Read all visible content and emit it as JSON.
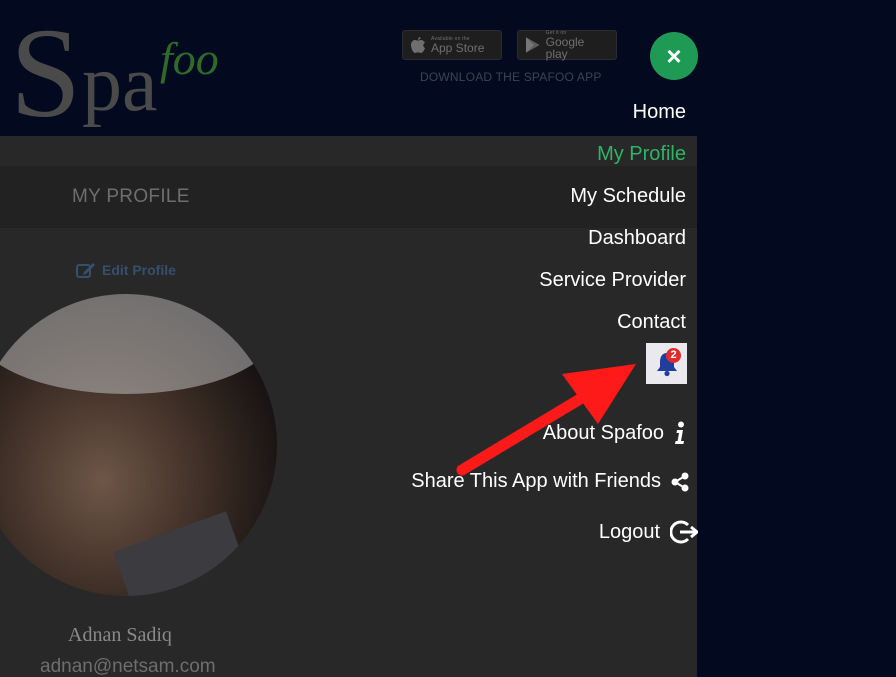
{
  "app": {
    "logo_text": "Spafoo"
  },
  "header": {
    "app_store": {
      "small": "Available on the",
      "big": "App Store"
    },
    "google_play": {
      "small": "Get it on",
      "big": "Google play"
    },
    "download_text": "DOWNLOAD THE SPAFOO APP"
  },
  "profile": {
    "title": "MY PROFILE",
    "edit_label": "Edit Profile",
    "name": "Adnan Sadiq",
    "email": "adnan@netsam.com"
  },
  "menu": {
    "close_icon": "×",
    "items": [
      {
        "label": "Home",
        "active": false
      },
      {
        "label": "My Profile",
        "active": true
      },
      {
        "label": "My Schedule",
        "active": false
      },
      {
        "label": "Dashboard",
        "active": false
      },
      {
        "label": "Service Provider",
        "active": false
      },
      {
        "label": "Contact",
        "active": false
      }
    ],
    "notifications": {
      "icon": "bell-icon",
      "count": "2"
    },
    "about": {
      "label": "About Spafoo",
      "icon": "info-icon"
    },
    "share": {
      "label": "Share This App with Friends",
      "icon": "share-icon"
    },
    "logout": {
      "label": "Logout",
      "icon": "logout-icon"
    }
  },
  "colors": {
    "menu_bg": "#030a1f",
    "active": "#2db467",
    "close_button": "#1f9a55",
    "badge": "#e22a2a",
    "arrow": "#ff1a1a"
  }
}
